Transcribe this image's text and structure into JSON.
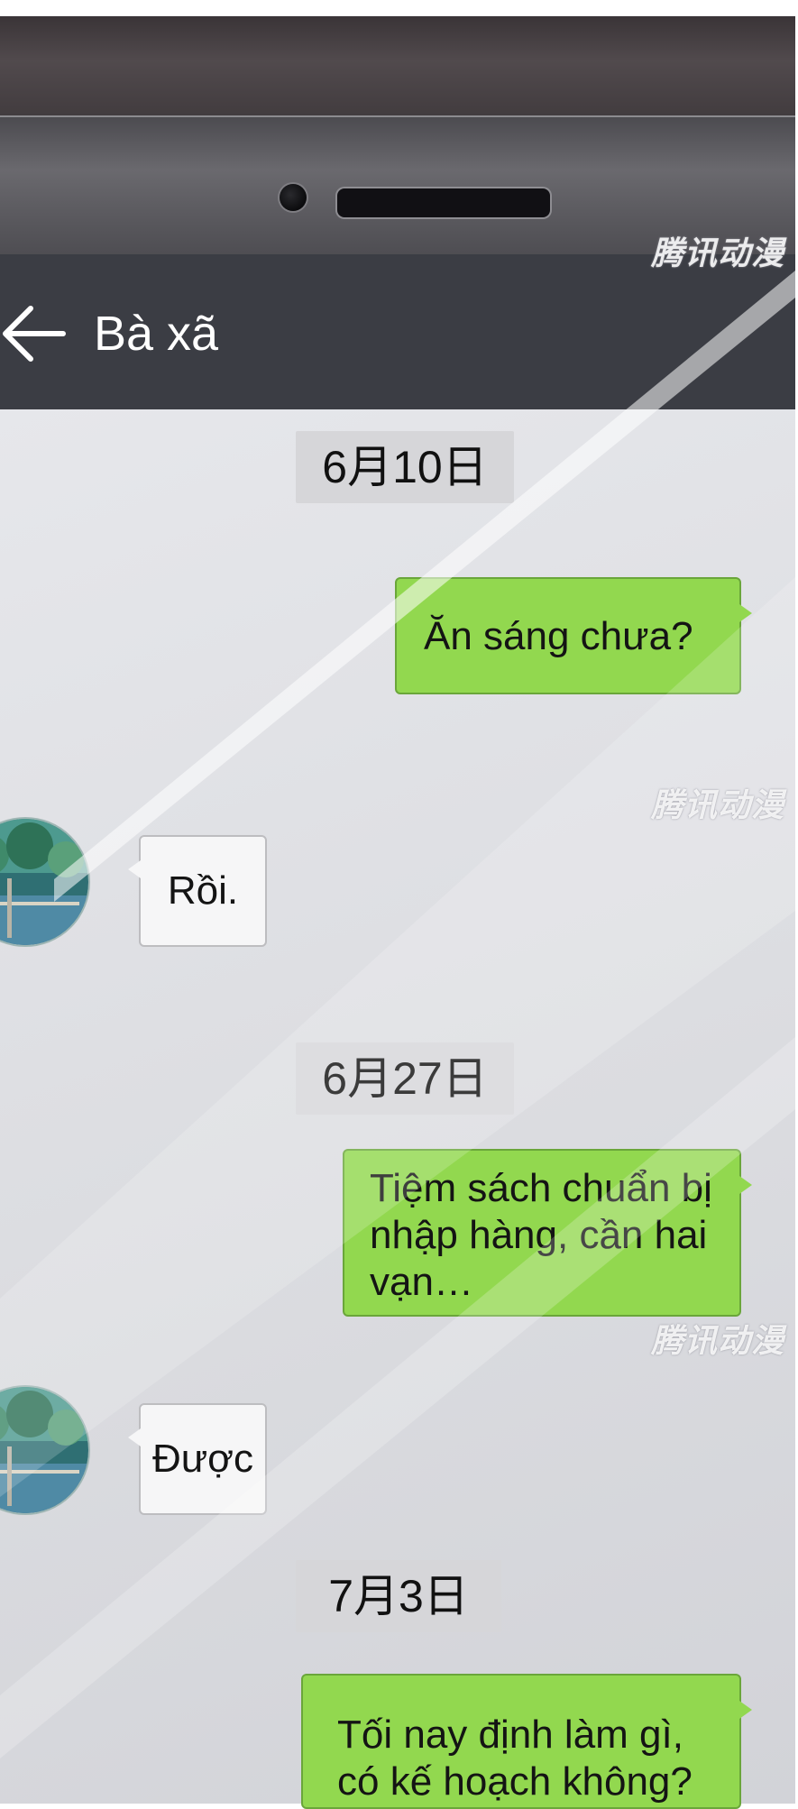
{
  "header": {
    "contact_name": "Bà xã"
  },
  "watermark": "腾讯动漫",
  "messages": [
    {
      "type": "date",
      "text": "6月10日"
    },
    {
      "type": "sent",
      "text": "Ăn sáng chưa?"
    },
    {
      "type": "received",
      "text": "Rồi."
    },
    {
      "type": "date",
      "text": "6月27日"
    },
    {
      "type": "sent",
      "text": "Tiệm sách chuẩn bị nhập hàng, cần hai vạn…"
    },
    {
      "type": "received",
      "text": "Được"
    },
    {
      "type": "date",
      "text": "7月3日"
    },
    {
      "type": "sent",
      "text": "Tối nay định làm gì, có kế hoạch không?"
    }
  ],
  "icons": {
    "back": "back-arrow-icon",
    "avatar": "contact-avatar"
  }
}
